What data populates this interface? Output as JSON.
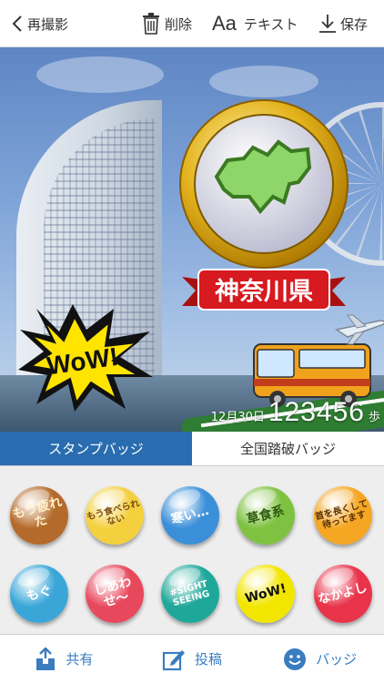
{
  "toolbar": {
    "back_label": "再撮影",
    "delete_label": "削除",
    "text_icon_glyph": "Aa",
    "text_label": "テキスト",
    "save_label": "保存"
  },
  "photo": {
    "badge_label": "神奈川県",
    "wow_label": "WoW!",
    "step_date": "12月30日",
    "step_count": "123456",
    "step_unit": "歩"
  },
  "tabs": [
    {
      "label": "スタンプバッジ",
      "active": true
    },
    {
      "label": "全国踏破バッジ",
      "active": false
    }
  ],
  "badges": [
    {
      "text": "もう疲れた",
      "color": "#b46a2a",
      "text_color": "#fff0c8"
    },
    {
      "text": "もう食べられない",
      "color": "#f4d03f",
      "text_color": "#7a4a10"
    },
    {
      "text": "寒い…",
      "color": "#3b8fd8",
      "text_color": "#ffffff"
    },
    {
      "text": "草食系",
      "color": "#7fc242",
      "text_color": "#2e5a10"
    },
    {
      "text": "首を長くして待ってます",
      "color": "#f5a623",
      "text_color": "#5a3000"
    },
    {
      "text": "もぐ",
      "color": "#3aa6d8",
      "text_color": "#ffffff"
    },
    {
      "text": "しあわせ〜",
      "color": "#e8485c",
      "text_color": "#ffffff"
    },
    {
      "text": "#SIGHT SEEING",
      "color": "#1fa89a",
      "text_color": "#ffffff"
    },
    {
      "text": "WoW!",
      "color": "#f2e600",
      "text_color": "#111111"
    },
    {
      "text": "なかよし",
      "color": "#e8334a",
      "text_color": "#ffffff"
    }
  ],
  "bottom": {
    "share_label": "共有",
    "post_label": "投稿",
    "badge_label": "バッジ"
  },
  "colors": {
    "accent": "#2a6cb0",
    "icon_blue": "#3a7cc0"
  }
}
